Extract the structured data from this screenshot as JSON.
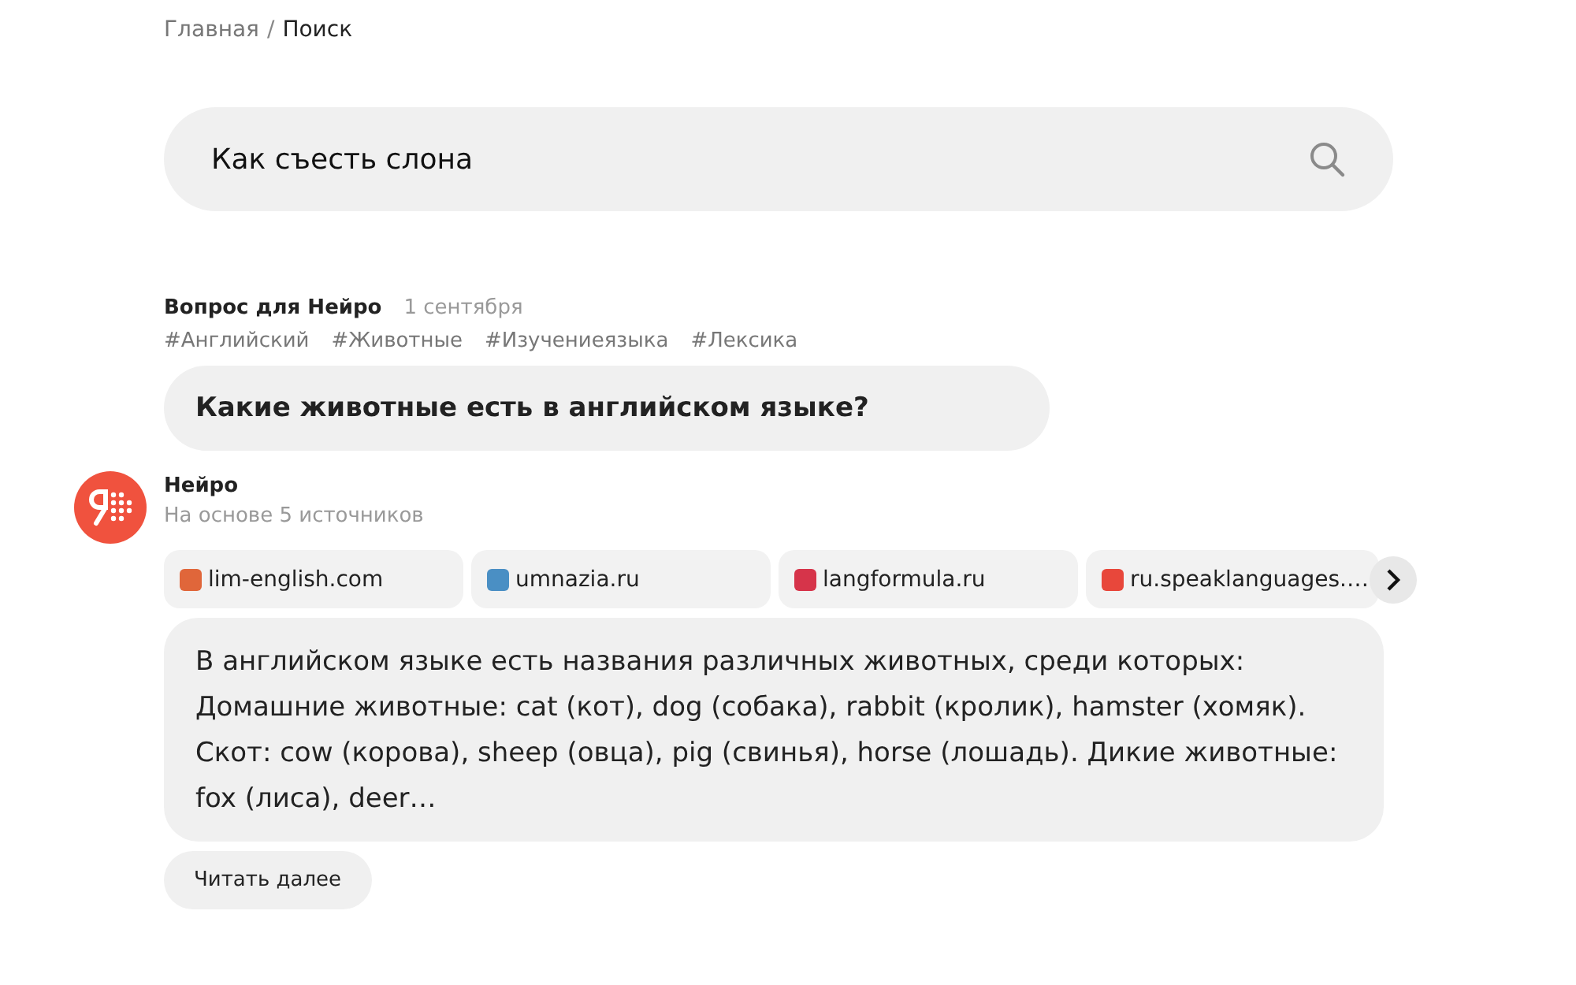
{
  "breadcrumbs": [
    {
      "label": "Главная",
      "current": false
    },
    {
      "label": "/",
      "kind": "separator"
    },
    {
      "label": "Поиск",
      "current": true
    }
  ],
  "search": {
    "value": "Как съесть слона"
  },
  "question": {
    "author": "Вопрос для Нейро",
    "date": "1 сентября",
    "tags": [
      "#Английский",
      "#Животные",
      "#Изучениеязыка",
      "#Лексика"
    ],
    "text": "Какие животные есть в английском языке?"
  },
  "answer": {
    "author": "Нейро",
    "subtitle": "На основе 5 источников",
    "sources": [
      {
        "label": "lim-english.com",
        "color": "#e0663a"
      },
      {
        "label": "umnazia.ru",
        "color": "#4a8fc4"
      },
      {
        "label": "langformula.ru",
        "color": "#d6344a"
      },
      {
        "label": "ru.speaklanguages.…",
        "color": "#e8473b"
      }
    ],
    "text": "В английском языке есть названия различных животных, среди которых: Домашние животные: cat (кот), dog (собака), rabbit (кролик), hamster (хомяк). Скот: cow (корова), sheep (овца), pig (свинья), horse (лошадь). Дикие животные: fox (лиса), deer…",
    "more_button": "Читать далее"
  }
}
